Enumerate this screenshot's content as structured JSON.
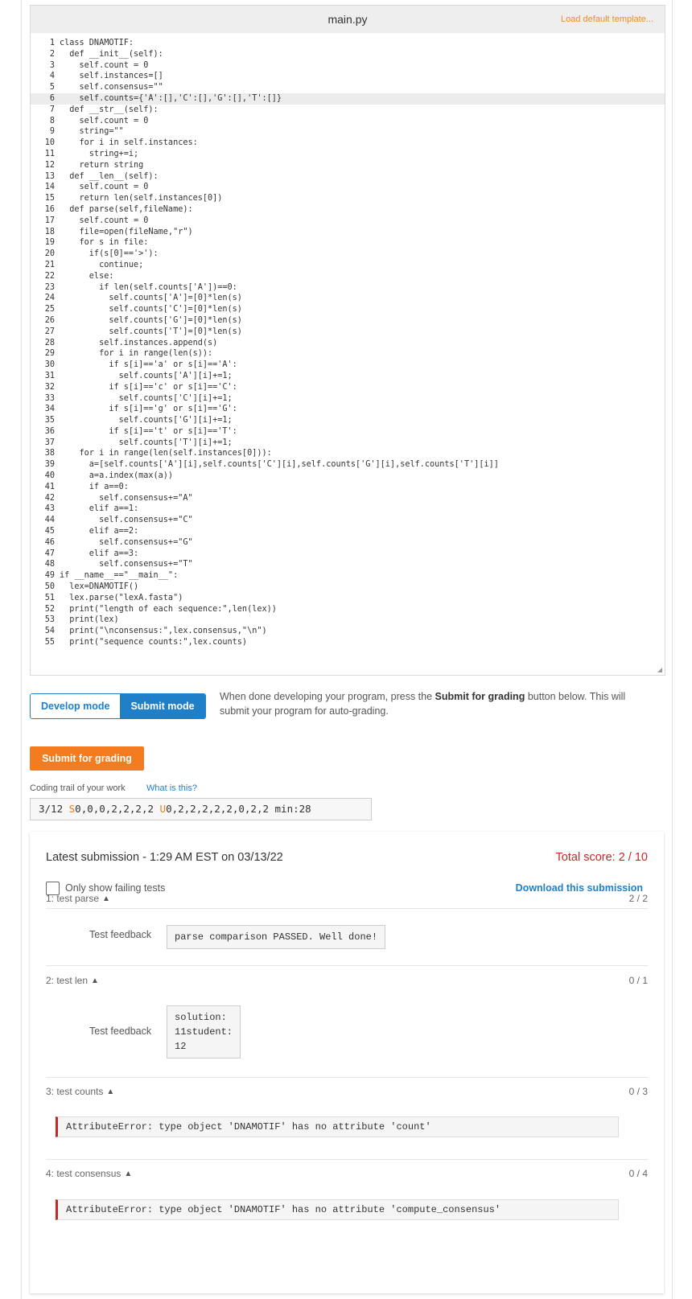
{
  "editor": {
    "file_name": "main.py",
    "load_template": "Load default template...",
    "active_line": 6,
    "lines": [
      "class DNAMOTIF:",
      "  def __init__(self):",
      "    self.count = 0",
      "    self.instances=[]",
      "    self.consensus=\"\"",
      "    self.counts={'A':[],'C':[],'G':[],'T':[]}",
      "  def __str__(self):",
      "    self.count = 0",
      "    string=\"\"",
      "    for i in self.instances:",
      "      string+=i;",
      "    return string",
      "  def __len__(self):",
      "    self.count = 0",
      "    return len(self.instances[0])",
      "  def parse(self,fileName):",
      "    self.count = 0",
      "    file=open(fileName,\"r\")",
      "    for s in file:",
      "      if(s[0]=='>'):",
      "        continue;",
      "      else:",
      "        if len(self.counts['A'])==0:",
      "          self.counts['A']=[0]*len(s)",
      "          self.counts['C']=[0]*len(s)",
      "          self.counts['G']=[0]*len(s)",
      "          self.counts['T']=[0]*len(s)",
      "        self.instances.append(s)",
      "        for i in range(len(s)):",
      "          if s[i]=='a' or s[i]=='A':",
      "            self.counts['A'][i]+=1;",
      "          if s[i]=='c' or s[i]=='C':",
      "            self.counts['C'][i]+=1;",
      "          if s[i]=='g' or s[i]=='G':",
      "            self.counts['G'][i]+=1;",
      "          if s[i]=='t' or s[i]=='T':",
      "            self.counts['T'][i]+=1;",
      "    for i in range(len(self.instances[0])):",
      "      a=[self.counts['A'][i],self.counts['C'][i],self.counts['G'][i],self.counts['T'][i]]",
      "      a=a.index(max(a))",
      "      if a==0:",
      "        self.consensus+=\"A\"",
      "      elif a==1:",
      "        self.consensus+=\"C\"",
      "      elif a==2:",
      "        self.consensus+=\"G\"",
      "      elif a==3:",
      "        self.consensus+=\"T\"",
      "if __name__==\"__main__\":",
      "  lex=DNAMOTIF()",
      "  lex.parse(\"lexA.fasta\")",
      "  print(\"length of each sequence:\",len(lex))",
      "  print(lex)",
      "  print(\"\\nconsensus:\",lex.consensus,\"\\n\")",
      "  print(\"sequence counts:\",lex.counts)"
    ]
  },
  "mode": {
    "develop_label": "Develop mode",
    "submit_label": "Submit mode",
    "desc_before": "When done developing your program, press the ",
    "desc_bold": "Submit for grading",
    "desc_after": " button below. This will submit your program for auto-grading."
  },
  "submit_button": "Submit for grading",
  "trail": {
    "label": "Coding trail of your work",
    "link": "What is this?",
    "prefix": "3/12 ",
    "s_mark": "S",
    "s_values": "0,0,0,2,2,2,2 ",
    "u_mark": "U",
    "u_values": "0,2,2,2,2,2,0,2,2 min:28"
  },
  "results": {
    "latest": "Latest submission - 1:29 AM EST on 03/13/22",
    "total": "Total score: 2 / 10",
    "only_failing": "Only show failing tests",
    "download": "Download this submission",
    "feedback_label": "Test feedback",
    "tests": [
      {
        "title": "1: test parse",
        "score": "2 / 2",
        "feedback": "parse comparison PASSED. Well done!"
      },
      {
        "title": "2: test len",
        "score": "0 / 1",
        "feedback": "solution:\n11student:\n12"
      },
      {
        "title": "3: test counts",
        "score": "0 / 3",
        "error": "AttributeError: type object 'DNAMOTIF' has no attribute 'count'"
      },
      {
        "title": "4: test consensus",
        "score": "0 / 4",
        "error": "AttributeError: type object 'DNAMOTIF' has no attribute 'compute_consensus'"
      }
    ]
  }
}
